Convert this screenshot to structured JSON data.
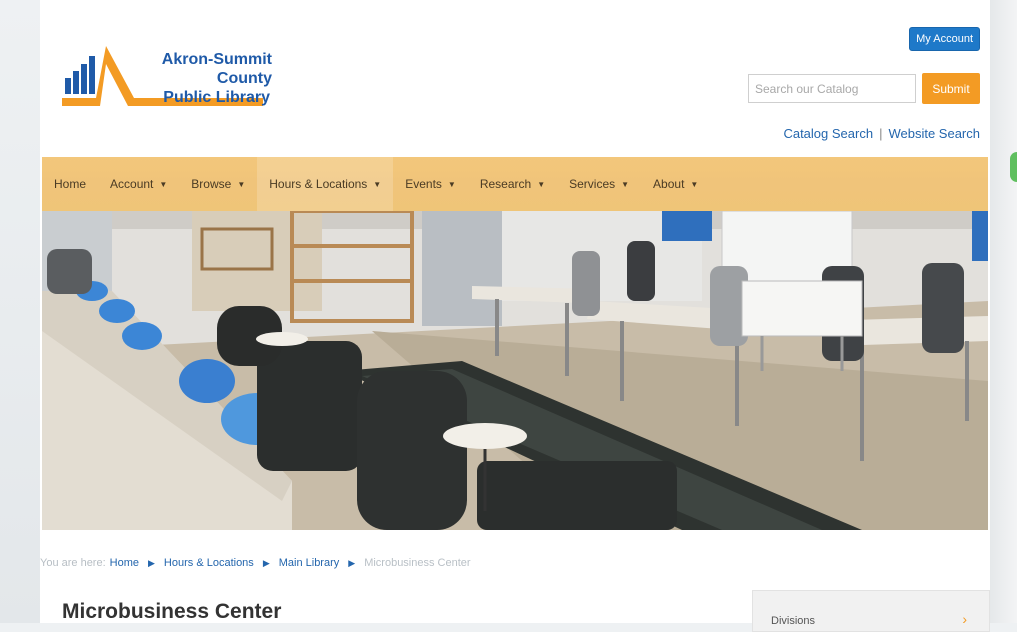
{
  "logo": {
    "line1": "Akron-Summit County",
    "line2": "Public Library"
  },
  "header": {
    "my_account_label": "My Account",
    "search_placeholder": "Search our Catalog",
    "submit_label": "Submit",
    "catalog_search_label": "Catalog Search",
    "separator": "|",
    "website_search_label": "Website Search"
  },
  "nav": {
    "items": [
      {
        "label": "Home",
        "caret": false
      },
      {
        "label": "Account",
        "caret": true
      },
      {
        "label": "Browse",
        "caret": true
      },
      {
        "label": "Hours & Locations",
        "caret": true
      },
      {
        "label": "Events",
        "caret": true
      },
      {
        "label": "Research",
        "caret": true
      },
      {
        "label": "Services",
        "caret": true
      },
      {
        "label": "About",
        "caret": true
      }
    ],
    "caret_glyph": "▼"
  },
  "breadcrumb": {
    "prefix": "You are here:",
    "items": [
      "Home",
      "Hours & Locations",
      "Main Library"
    ],
    "current": "Microbusiness Center"
  },
  "main": {
    "title": "Microbusiness Center"
  },
  "sidebar": {
    "box_label": "Divisions"
  },
  "colors": {
    "brand_blue": "#1f5aa8",
    "brand_orange": "#f39b24",
    "nav_bg": "#f0c47a"
  }
}
